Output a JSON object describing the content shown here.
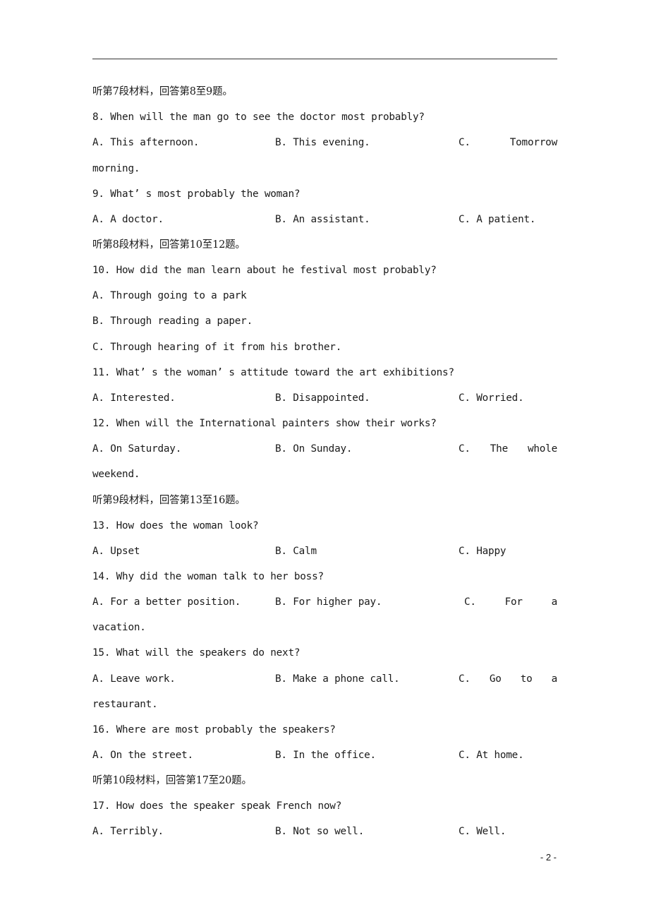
{
  "page": {
    "number": "- 2 -"
  },
  "sections": [
    {
      "header": "听第7段材料，回答第8至9题。"
    },
    {
      "header": "听第8段材料，回答第10至12题。"
    },
    {
      "header": "听第9段材料，回答第13至16题。"
    },
    {
      "header": "听第10段材料，回答第17至20题。"
    }
  ],
  "questions": [
    {
      "q": "8. When will the man go to see the doctor most probably?",
      "a": "A. This afternoon.",
      "b": "B. This evening.",
      "c_parts": [
        "C.",
        "Tomorrow"
      ],
      "c_wrap": "morning."
    },
    {
      "q": "9. What’ s most probably the woman?",
      "a": "A. A doctor.",
      "b": "B. An assistant.",
      "c": "C. A patient."
    },
    {
      "q": "10. How did the man learn about he festival most probably?",
      "a": "A. Through going to a park",
      "b": "B. Through reading a paper.",
      "c": "C. Through hearing of it from his brother."
    },
    {
      "q": "11. What’ s the woman’ s attitude toward the art exhibitions?",
      "a": "A. Interested.",
      "b": "B. Disappointed.",
      "c": "C. Worried."
    },
    {
      "q": "12. When will the International painters show their works?",
      "a": "A. On Saturday.",
      "b": "B. On Sunday.",
      "c_parts": [
        "C.",
        "The",
        "whole"
      ],
      "c_wrap": "weekend."
    },
    {
      "q": "13. How does the woman look?",
      "a": "A. Upset",
      "b": "B. Calm",
      "c": "C. Happy"
    },
    {
      "q": "14. Why did the woman talk to her boss?",
      "a": "A. For a better position.",
      "b": "B. For higher pay.",
      "c_parts": [
        "C.",
        "For",
        "a"
      ],
      "c_wrap": "vacation."
    },
    {
      "q": "15. What will the speakers do next?",
      "a": "A. Leave work.",
      "b": "B. Make a phone call.",
      "c_parts": [
        "C.",
        "Go",
        "to",
        "a"
      ],
      "c_wrap": "restaurant."
    },
    {
      "q": "16. Where are most probably the speakers?",
      "a": "A. On the street.",
      "b": "B. In the office.",
      "c": "C. At home."
    },
    {
      "q": "17. How does the speaker speak French now?",
      "a": "A. Terribly.",
      "b": "B. Not so well.",
      "c": "C. Well."
    }
  ]
}
